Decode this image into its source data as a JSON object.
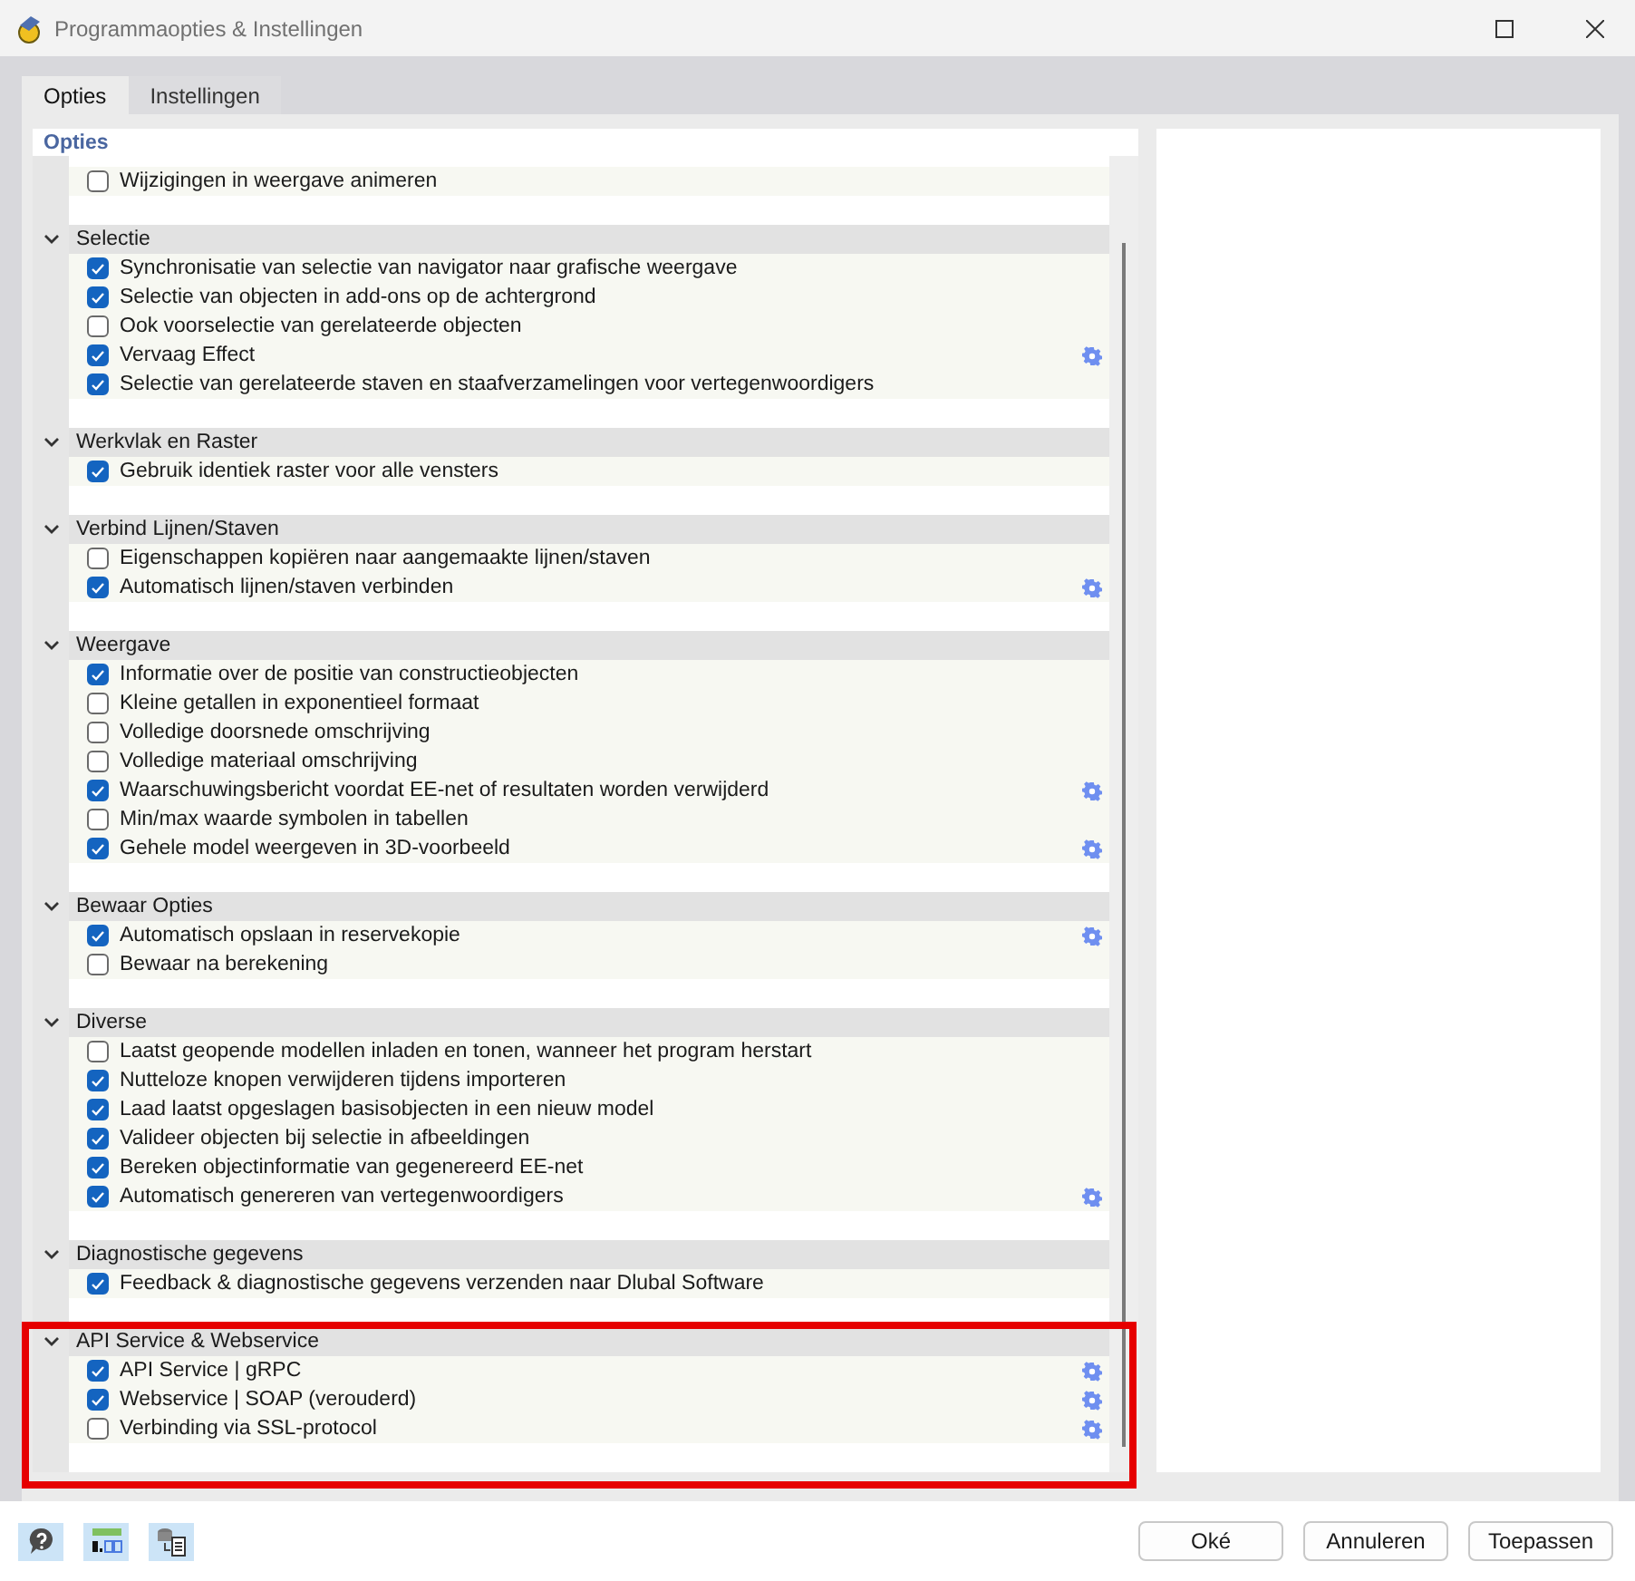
{
  "window": {
    "title": "Programmaopties & Instellingen"
  },
  "tabs": [
    {
      "label": "Opties",
      "selected": true
    },
    {
      "label": "Instellingen",
      "selected": false
    }
  ],
  "panel": {
    "title": "Opties"
  },
  "sections": [
    {
      "items": [
        {
          "label": "Wijzigingen in weergave animeren",
          "checked": false,
          "settings": false
        }
      ]
    },
    {
      "title": "Selectie",
      "expanded": true,
      "highlighted": false,
      "items": [
        {
          "label": "Synchronisatie van selectie van navigator naar grafische weergave",
          "checked": true,
          "settings": false
        },
        {
          "label": "Selectie van objecten in add-ons op de achtergrond",
          "checked": true,
          "settings": false
        },
        {
          "label": "Ook voorselectie van gerelateerde objecten",
          "checked": false,
          "settings": false
        },
        {
          "label": "Vervaag Effect",
          "checked": true,
          "settings": true
        },
        {
          "label": "Selectie van gerelateerde staven en staafverzamelingen voor vertegenwoordigers",
          "checked": true,
          "settings": false
        }
      ]
    },
    {
      "title": "Werkvlak en Raster",
      "expanded": true,
      "highlighted": false,
      "items": [
        {
          "label": "Gebruik identiek raster voor alle vensters",
          "checked": true,
          "settings": false
        }
      ]
    },
    {
      "title": "Verbind Lijnen/Staven",
      "expanded": true,
      "highlighted": false,
      "items": [
        {
          "label": "Eigenschappen kopiëren naar aangemaakte lijnen/staven",
          "checked": false,
          "settings": false
        },
        {
          "label": "Automatisch lijnen/staven verbinden",
          "checked": true,
          "settings": true
        }
      ]
    },
    {
      "title": "Weergave",
      "expanded": true,
      "highlighted": false,
      "items": [
        {
          "label": "Informatie over de positie van constructieobjecten",
          "checked": true,
          "settings": false
        },
        {
          "label": "Kleine getallen in exponentieel formaat",
          "checked": false,
          "settings": false
        },
        {
          "label": "Volledige doorsnede omschrijving",
          "checked": false,
          "settings": false
        },
        {
          "label": "Volledige materiaal omschrijving",
          "checked": false,
          "settings": false
        },
        {
          "label": "Waarschuwingsbericht voordat EE-net of resultaten worden verwijderd",
          "checked": true,
          "settings": true
        },
        {
          "label": "Min/max waarde symbolen in tabellen",
          "checked": false,
          "settings": false
        },
        {
          "label": "Gehele model weergeven in 3D-voorbeeld",
          "checked": true,
          "settings": true
        }
      ]
    },
    {
      "title": "Bewaar Opties",
      "expanded": true,
      "highlighted": false,
      "items": [
        {
          "label": "Automatisch opslaan in reservekopie",
          "checked": true,
          "settings": true
        },
        {
          "label": "Bewaar na berekening",
          "checked": false,
          "settings": false
        }
      ]
    },
    {
      "title": "Diverse",
      "expanded": true,
      "highlighted": false,
      "items": [
        {
          "label": "Laatst geopende modellen inladen en tonen, wanneer het program herstart",
          "checked": false,
          "settings": false
        },
        {
          "label": "Nutteloze knopen verwijderen tijdens importeren",
          "checked": true,
          "settings": false
        },
        {
          "label": "Laad laatst opgeslagen basisobjecten in een nieuw model",
          "checked": true,
          "settings": false
        },
        {
          "label": "Valideer objecten bij selectie in afbeeldingen",
          "checked": true,
          "settings": false
        },
        {
          "label": "Bereken objectinformatie van gegenereerd EE-net",
          "checked": true,
          "settings": false
        },
        {
          "label": "Automatisch genereren van vertegenwoordigers",
          "checked": true,
          "settings": true
        }
      ]
    },
    {
      "title": "Diagnostische gegevens",
      "expanded": true,
      "highlighted": false,
      "items": [
        {
          "label": "Feedback & diagnostische gegevens verzenden naar Dlubal Software",
          "checked": true,
          "settings": false
        }
      ]
    },
    {
      "title": "API Service & Webservice",
      "expanded": true,
      "highlighted": true,
      "items": [
        {
          "label": "API Service | gRPC",
          "checked": true,
          "settings": true
        },
        {
          "label": "Webservice | SOAP (verouderd)",
          "checked": true,
          "settings": true
        },
        {
          "label": "Verbinding via SSL-protocol",
          "checked": false,
          "settings": true
        }
      ]
    }
  ],
  "buttons": [
    {
      "label": "Oké"
    },
    {
      "label": "Annuleren"
    },
    {
      "label": "Toepassen"
    }
  ]
}
